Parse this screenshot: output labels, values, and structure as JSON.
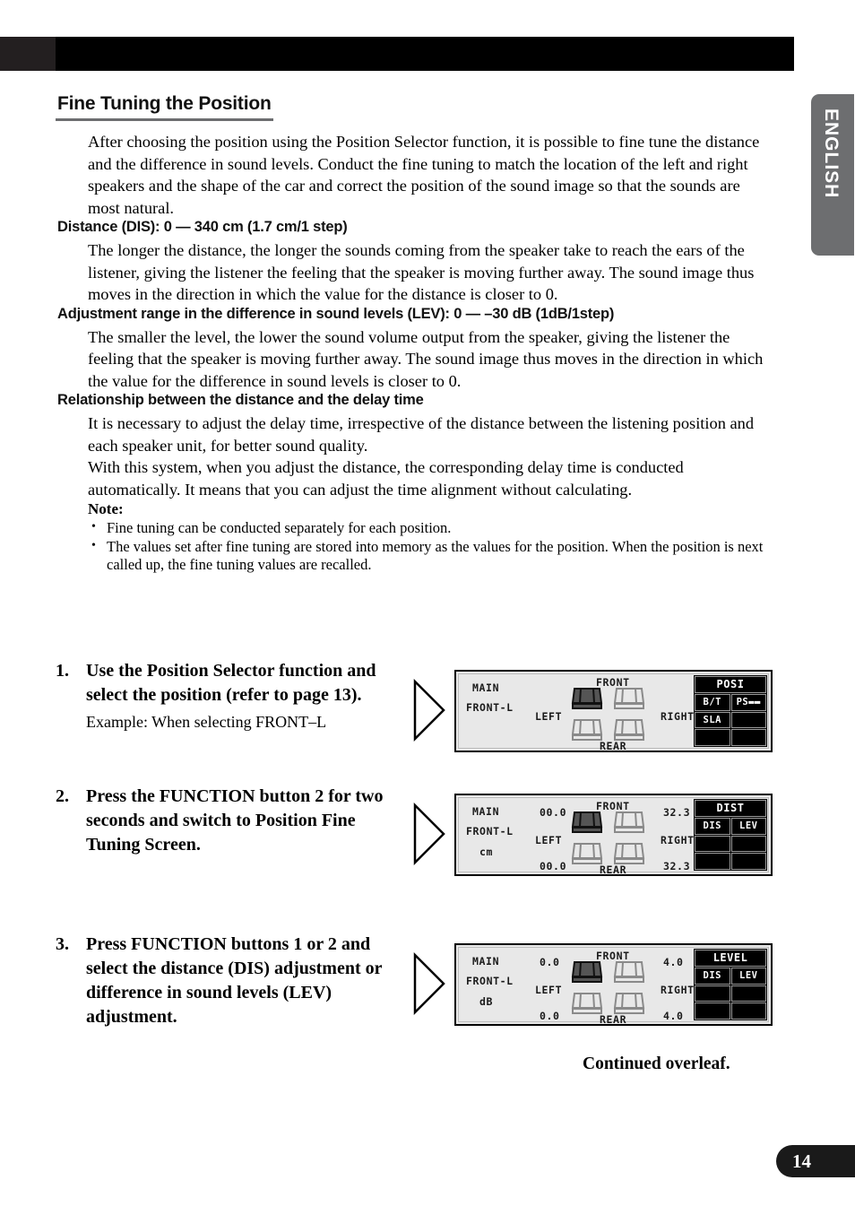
{
  "language_tab": "ENGLISH",
  "page_number": "14",
  "section": {
    "title": "Fine Tuning the Position",
    "intro": "After choosing the position using the Position Selector function, it is possible to fine tune the distance and the difference in sound levels. Conduct the fine tuning to match the location of the left and right speakers and the shape of the car and correct the position of the sound image so that the sounds are most natural."
  },
  "subsections": [
    {
      "heading": "Distance (DIS): 0 — 340 cm (1.7 cm/1 step)",
      "body": "The longer the distance, the longer the sounds coming from the speaker take to reach the ears of the listener, giving the listener the feeling that the speaker is moving further away. The sound image thus moves in the direction in which the value for the distance is closer to 0."
    },
    {
      "heading": "Adjustment range in the difference in sound levels (LEV): 0 — –30 dB (1dB/1step)",
      "body": "The smaller the level, the lower the sound volume output from the speaker, giving the listener the feeling that the speaker is moving further away. The sound image thus moves in the direction in which the value for the difference in sound levels is closer to 0."
    },
    {
      "heading": "Relationship between the distance and the delay time",
      "body": "It is necessary to adjust the delay time, irrespective of the distance between the listening position and each speaker unit, for better sound quality.\nWith this system, when you adjust the distance, the corresponding delay time is conducted automatically. It means that you can adjust the time alignment without calculating."
    }
  ],
  "note": {
    "heading": "Note:",
    "items": [
      "Fine tuning can be conducted separately for each position.",
      "The values set after fine tuning are stored into memory as the values for the position. When the position is next called up, the fine tuning values are recalled."
    ]
  },
  "steps": [
    {
      "number": "1.",
      "text": "Use the Position Selector function and select the position (refer to page 13).",
      "sub": "Example: When selecting FRONT–L"
    },
    {
      "number": "2.",
      "text": "Press the FUNCTION button 2 for two seconds and switch to Position Fine Tuning Screen.",
      "sub": ""
    },
    {
      "number": "3.",
      "text": "Press FUNCTION buttons 1 or 2 and select the distance (DIS) adjustment or difference in sound levels (LEV) adjustment.",
      "sub": ""
    }
  ],
  "lcd_panels": [
    {
      "source": "MAIN",
      "position": "FRONT-L",
      "unit": "",
      "left_label": "LEFT",
      "right_label": "RIGHT",
      "front_label": "FRONT",
      "rear_label": "REAR",
      "value_top_left": "",
      "value_top_right": "",
      "value_bottom_left": "",
      "value_bottom_right": "",
      "mode_header": "POSI",
      "buttons": [
        "B/T",
        "PS▬▬",
        "SLA",
        "",
        "",
        ""
      ]
    },
    {
      "source": "MAIN",
      "position": "FRONT-L",
      "unit": "cm",
      "left_label": "LEFT",
      "right_label": "RIGHT",
      "front_label": "FRONT",
      "rear_label": "REAR",
      "value_top_left": "00.0",
      "value_top_right": "32.3",
      "value_bottom_left": "00.0",
      "value_bottom_right": "32.3",
      "mode_header": "DIST",
      "buttons": [
        "DIS",
        "LEV",
        "",
        "",
        "",
        ""
      ]
    },
    {
      "source": "MAIN",
      "position": "FRONT-L",
      "unit": "dB",
      "left_label": "LEFT",
      "right_label": "RIGHT",
      "front_label": "FRONT",
      "rear_label": "REAR",
      "value_top_left": "0.0",
      "value_top_right": "4.0",
      "value_bottom_left": "0.0",
      "value_bottom_right": "4.0",
      "mode_header": "LEVEL",
      "buttons": [
        "DIS",
        "LEV",
        "",
        "",
        "",
        ""
      ]
    }
  ],
  "footer": {
    "continued": "Continued overleaf."
  }
}
